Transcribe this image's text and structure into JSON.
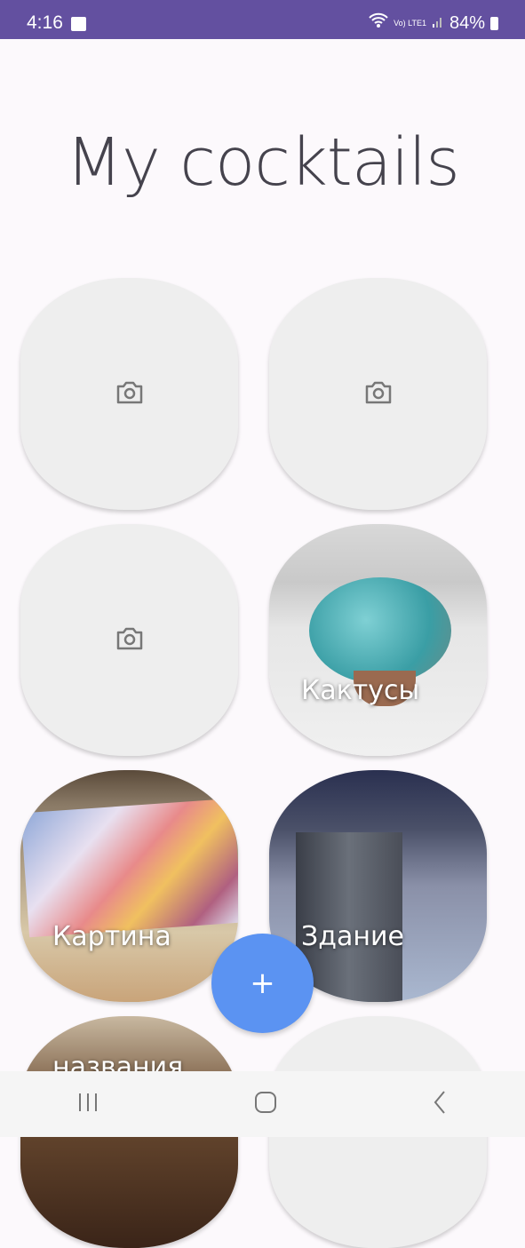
{
  "status_bar": {
    "time": "4:16",
    "network": "Vo) LTE1",
    "battery": "84%"
  },
  "title": "My cocktails",
  "cards": [
    {
      "label": "",
      "image": false
    },
    {
      "label": "",
      "image": false
    },
    {
      "label": "",
      "image": false
    },
    {
      "label": "Кактусы",
      "image": true
    },
    {
      "label": "Картина",
      "image": true
    },
    {
      "label": "Здание",
      "image": true
    },
    {
      "label": "названия",
      "image": true
    },
    {
      "label": "",
      "image": false
    }
  ],
  "fab": {
    "label": "+"
  },
  "colors": {
    "status_bar": "#6350a0",
    "fab": "#5b93f2",
    "card_placeholder": "#eeeeee"
  }
}
